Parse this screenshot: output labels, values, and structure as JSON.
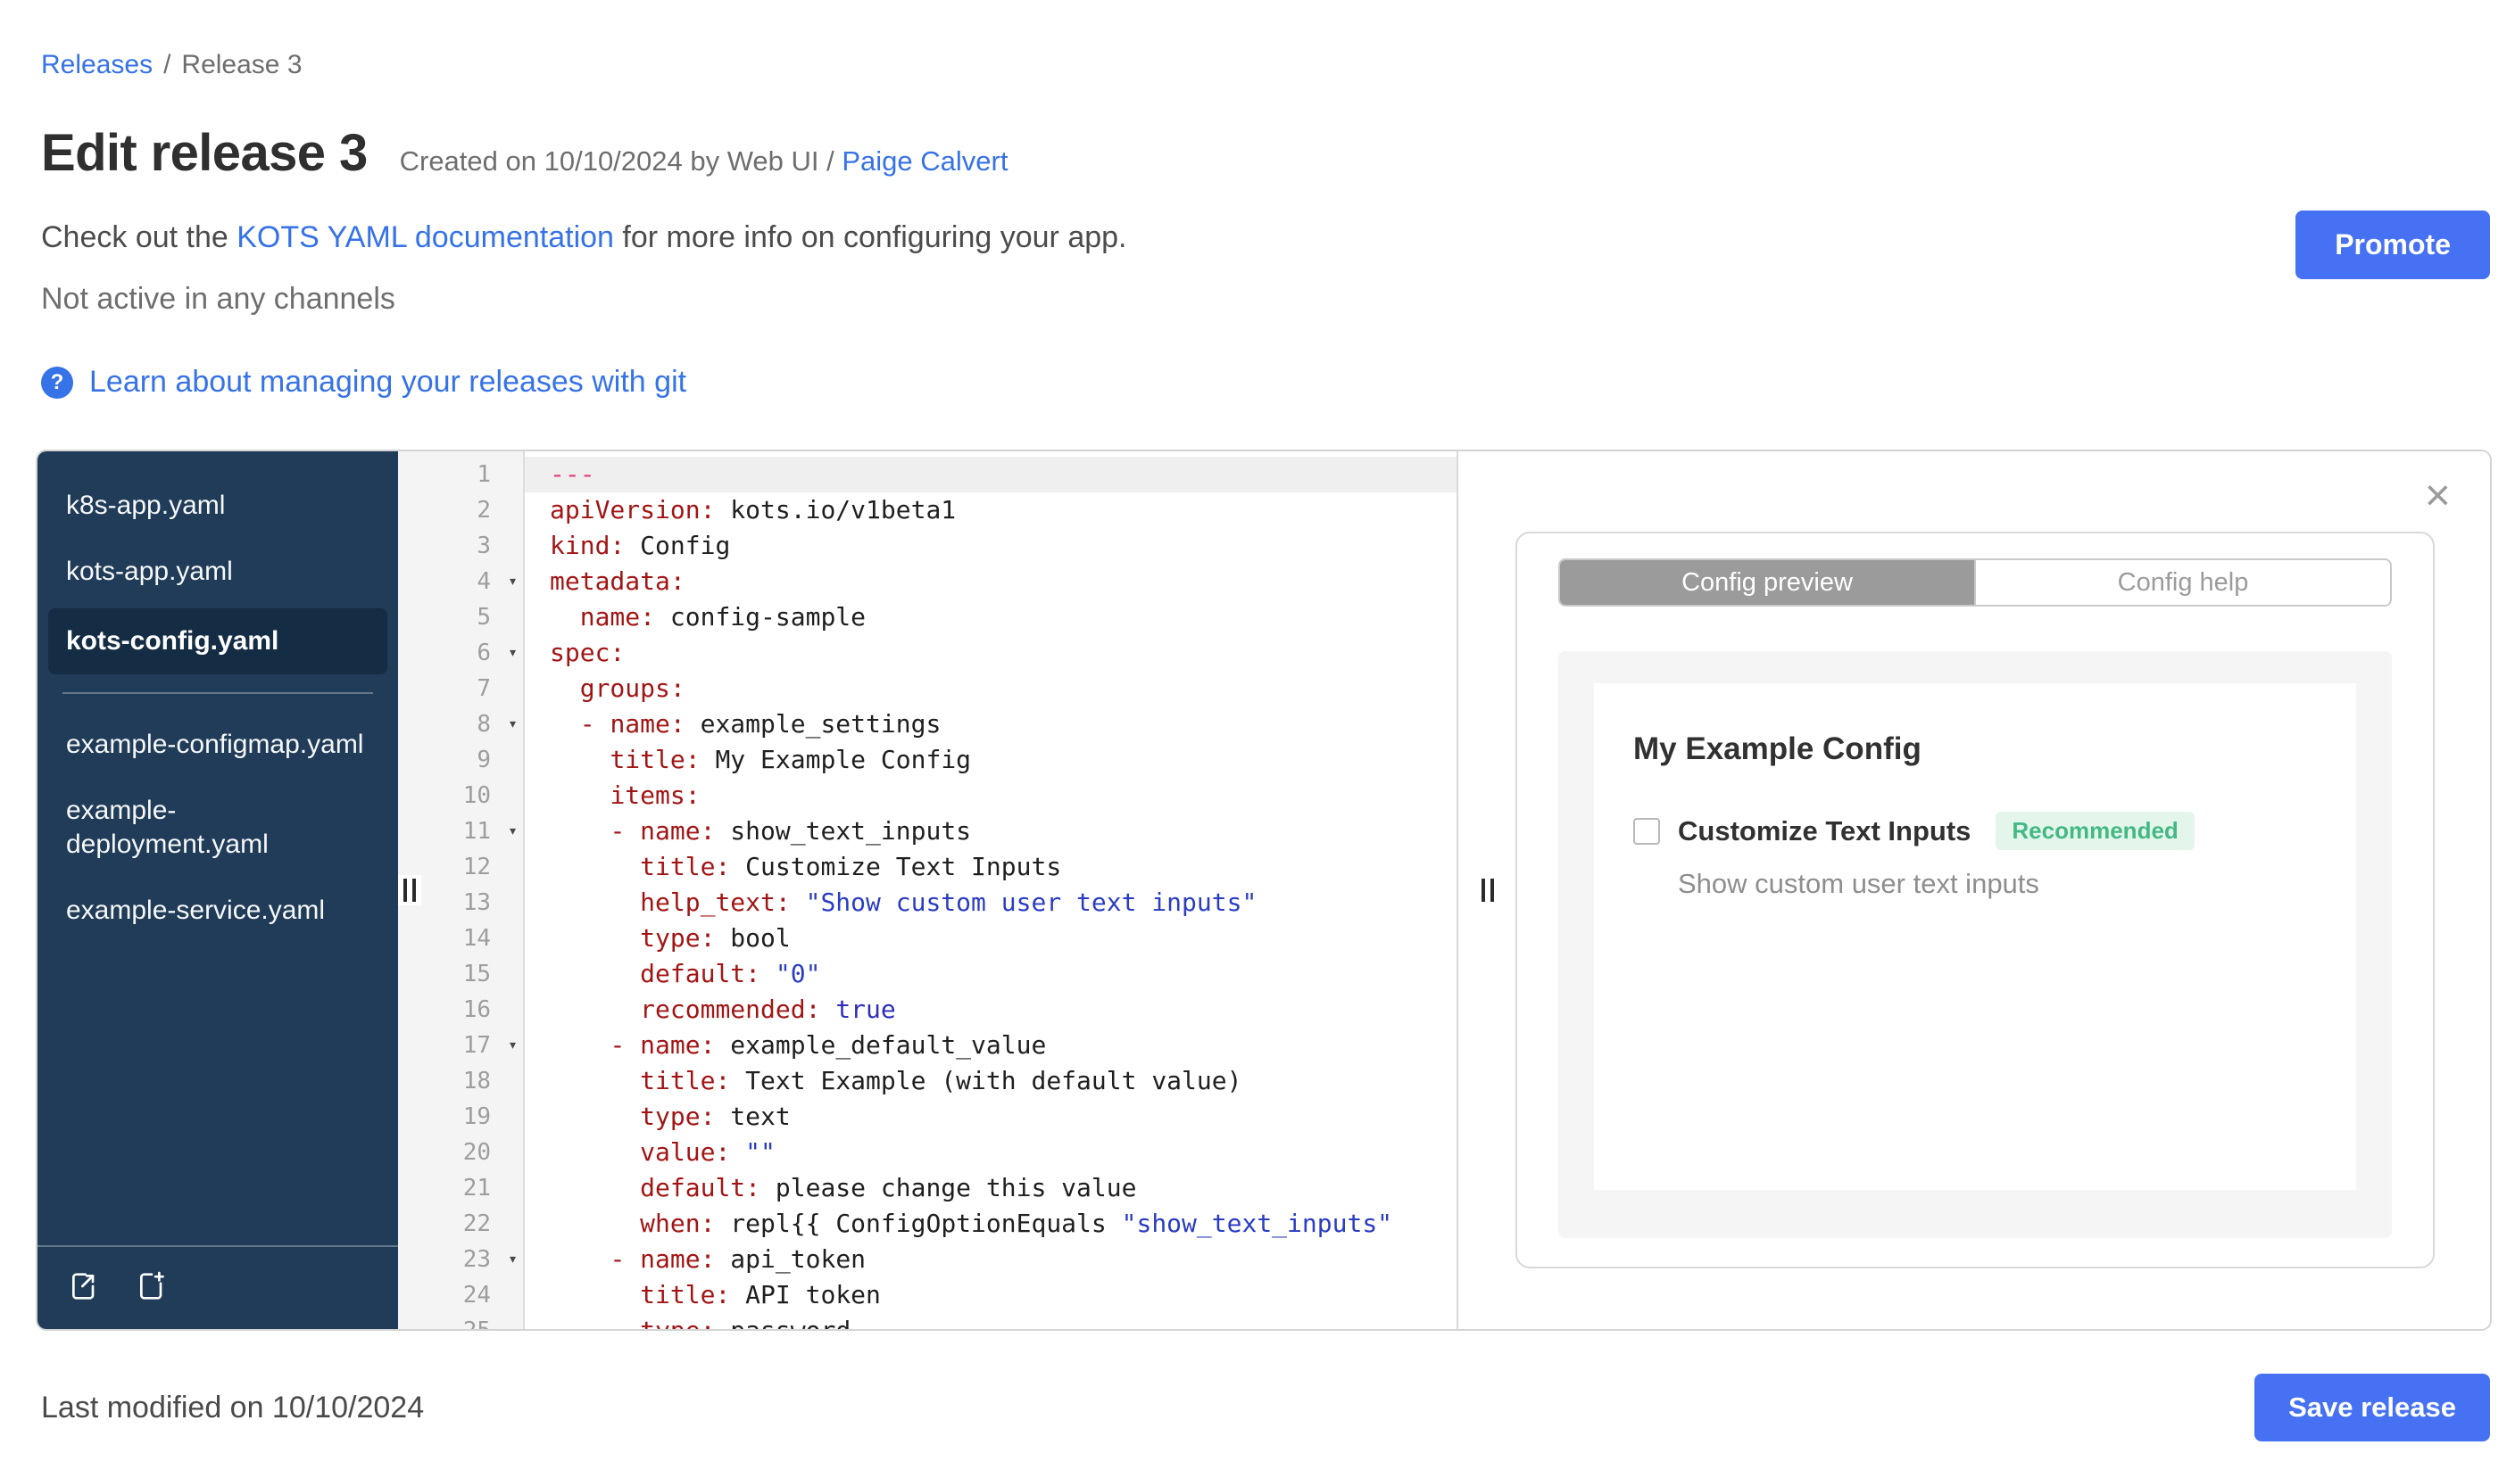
{
  "colors": {
    "accent_blue": "#4571f2",
    "link_blue": "#3672e8",
    "sidebar_bg": "#203c58",
    "sidebar_selected_bg": "#142c44",
    "badge_green_text": "#44b984",
    "badge_green_bg": "#e4f6ec",
    "syntax_key": "#a31515",
    "syntax_string": "#2a3cc4",
    "syntax_atom": "#2d2dbd",
    "syntax_hr": "#e0427e"
  },
  "breadcrumb": {
    "link": "Releases",
    "separator": "/",
    "current": "Release 3"
  },
  "header": {
    "title": "Edit release 3",
    "created_prefix": "Created on 10/10/2024 by Web UI /",
    "created_author": "Paige Calvert",
    "doc_prefix": "Check out the ",
    "doc_link": "KOTS YAML documentation",
    "doc_suffix": " for more info on configuring your app.",
    "channel_status": "Not active in any channels",
    "promote_label": "Promote",
    "help_icon": "?",
    "git_link": "Learn about managing your releases with git"
  },
  "file_tree": {
    "items": [
      {
        "label": "k8s-app.yaml",
        "selected": false,
        "group": 1
      },
      {
        "label": "kots-app.yaml",
        "selected": false,
        "group": 1
      },
      {
        "label": "kots-config.yaml",
        "selected": true,
        "group": 1
      },
      {
        "label": "example-configmap.yaml",
        "selected": false,
        "group": 2
      },
      {
        "label": "example-deployment.yaml",
        "selected": false,
        "group": 2
      },
      {
        "label": "example-service.yaml",
        "selected": false,
        "group": 2
      }
    ],
    "icons": [
      "upload-file-icon",
      "new-file-icon"
    ]
  },
  "editor": {
    "lines": [
      {
        "n": 1,
        "fold": false,
        "active": true,
        "segments": [
          [
            "---",
            "hr"
          ]
        ]
      },
      {
        "n": 2,
        "fold": false,
        "segments": [
          [
            "apiVersion:",
            "key"
          ],
          [
            " kots.io/v1beta1",
            "plain"
          ]
        ]
      },
      {
        "n": 3,
        "fold": false,
        "segments": [
          [
            "kind:",
            "key"
          ],
          [
            " Config",
            "plain"
          ]
        ]
      },
      {
        "n": 4,
        "fold": true,
        "segments": [
          [
            "metadata:",
            "key"
          ]
        ]
      },
      {
        "n": 5,
        "fold": false,
        "segments": [
          [
            "  ",
            "plain"
          ],
          [
            "name:",
            "key"
          ],
          [
            " config-sample",
            "plain"
          ]
        ]
      },
      {
        "n": 6,
        "fold": true,
        "segments": [
          [
            "spec:",
            "key"
          ]
        ]
      },
      {
        "n": 7,
        "fold": false,
        "segments": [
          [
            "  ",
            "plain"
          ],
          [
            "groups:",
            "key"
          ]
        ]
      },
      {
        "n": 8,
        "fold": true,
        "segments": [
          [
            "  ",
            "plain"
          ],
          [
            "-",
            "dash"
          ],
          [
            " ",
            "plain"
          ],
          [
            "name:",
            "key"
          ],
          [
            " example_settings",
            "plain"
          ]
        ]
      },
      {
        "n": 9,
        "fold": false,
        "segments": [
          [
            "    ",
            "plain"
          ],
          [
            "title:",
            "key"
          ],
          [
            " My Example Config",
            "plain"
          ]
        ]
      },
      {
        "n": 10,
        "fold": false,
        "segments": [
          [
            "    ",
            "plain"
          ],
          [
            "items:",
            "key"
          ]
        ]
      },
      {
        "n": 11,
        "fold": true,
        "segments": [
          [
            "    ",
            "plain"
          ],
          [
            "-",
            "dash"
          ],
          [
            " ",
            "plain"
          ],
          [
            "name:",
            "key"
          ],
          [
            " show_text_inputs",
            "plain"
          ]
        ]
      },
      {
        "n": 12,
        "fold": false,
        "segments": [
          [
            "      ",
            "plain"
          ],
          [
            "title:",
            "key"
          ],
          [
            " Customize Text Inputs",
            "plain"
          ]
        ]
      },
      {
        "n": 13,
        "fold": false,
        "segments": [
          [
            "      ",
            "plain"
          ],
          [
            "help_text:",
            "key"
          ],
          [
            " ",
            "plain"
          ],
          [
            "\"Show custom user text inputs\"",
            "str"
          ]
        ]
      },
      {
        "n": 14,
        "fold": false,
        "segments": [
          [
            "      ",
            "plain"
          ],
          [
            "type:",
            "key"
          ],
          [
            " bool",
            "plain"
          ]
        ]
      },
      {
        "n": 15,
        "fold": false,
        "segments": [
          [
            "      ",
            "plain"
          ],
          [
            "default:",
            "key"
          ],
          [
            " ",
            "plain"
          ],
          [
            "\"0\"",
            "str"
          ]
        ]
      },
      {
        "n": 16,
        "fold": false,
        "segments": [
          [
            "      ",
            "plain"
          ],
          [
            "recommended:",
            "key"
          ],
          [
            " ",
            "plain"
          ],
          [
            "true",
            "atom"
          ]
        ]
      },
      {
        "n": 17,
        "fold": true,
        "segments": [
          [
            "    ",
            "plain"
          ],
          [
            "-",
            "dash"
          ],
          [
            " ",
            "plain"
          ],
          [
            "name:",
            "key"
          ],
          [
            " example_default_value",
            "plain"
          ]
        ]
      },
      {
        "n": 18,
        "fold": false,
        "segments": [
          [
            "      ",
            "plain"
          ],
          [
            "title:",
            "key"
          ],
          [
            " Text Example (with default value)",
            "plain"
          ]
        ]
      },
      {
        "n": 19,
        "fold": false,
        "segments": [
          [
            "      ",
            "plain"
          ],
          [
            "type:",
            "key"
          ],
          [
            " text",
            "plain"
          ]
        ]
      },
      {
        "n": 20,
        "fold": false,
        "segments": [
          [
            "      ",
            "plain"
          ],
          [
            "value:",
            "key"
          ],
          [
            " ",
            "plain"
          ],
          [
            "\"\"",
            "str"
          ]
        ]
      },
      {
        "n": 21,
        "fold": false,
        "segments": [
          [
            "      ",
            "plain"
          ],
          [
            "default:",
            "key"
          ],
          [
            " please change this value",
            "plain"
          ]
        ]
      },
      {
        "n": 22,
        "fold": false,
        "segments": [
          [
            "      ",
            "plain"
          ],
          [
            "when:",
            "key"
          ],
          [
            " repl{{ ConfigOptionEquals ",
            "plain"
          ],
          [
            "\"show_text_inputs\"",
            "str"
          ]
        ]
      },
      {
        "n": 23,
        "fold": true,
        "segments": [
          [
            "    ",
            "plain"
          ],
          [
            "-",
            "dash"
          ],
          [
            " ",
            "plain"
          ],
          [
            "name:",
            "key"
          ],
          [
            " api_token",
            "plain"
          ]
        ]
      },
      {
        "n": 24,
        "fold": false,
        "segments": [
          [
            "      ",
            "plain"
          ],
          [
            "title:",
            "key"
          ],
          [
            " API token",
            "plain"
          ]
        ]
      },
      {
        "n": 25,
        "fold": false,
        "segments": [
          [
            "      ",
            "plain"
          ],
          [
            "type:",
            "key"
          ],
          [
            " password",
            "plain"
          ]
        ]
      }
    ]
  },
  "preview": {
    "close_icon": "×",
    "tabs": [
      {
        "label": "Config preview",
        "active": true
      },
      {
        "label": "Config help",
        "active": false
      }
    ],
    "card": {
      "heading": "My Example Config",
      "checkbox_label": "Customize Text Inputs",
      "badge": "Recommended",
      "help_text": "Show custom user text inputs"
    }
  },
  "footer": {
    "last_modified": "Last modified on 10/10/2024",
    "save_label": "Save release"
  }
}
